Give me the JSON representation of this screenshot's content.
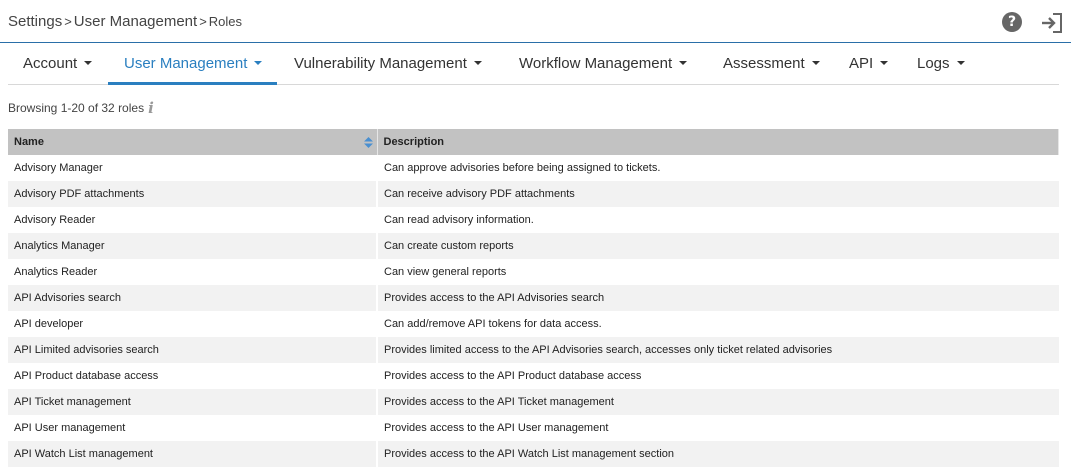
{
  "breadcrumb": {
    "items": [
      "Settings",
      "User Management",
      "Roles"
    ],
    "separator": ">"
  },
  "header": {
    "help_icon_glyph": "?",
    "icons": [
      "help-icon",
      "logout-icon"
    ]
  },
  "nav": {
    "active_color": "#2a7fc0",
    "tabs": [
      {
        "label": "Account",
        "active": false
      },
      {
        "label": "User Management",
        "active": true
      },
      {
        "label": "Vulnerability Management",
        "active": false
      },
      {
        "label": "Workflow Management",
        "active": false
      },
      {
        "label": "Assessment",
        "active": false
      },
      {
        "label": "API",
        "active": false
      },
      {
        "label": "Logs",
        "active": false
      }
    ]
  },
  "browsing": {
    "text": "Browsing 1-20 of 32 roles",
    "info_glyph": "i"
  },
  "table": {
    "columns": [
      "Name",
      "Description"
    ],
    "rows": [
      {
        "name": "Advisory Manager",
        "description": "Can approve advisories before being assigned to tickets."
      },
      {
        "name": "Advisory PDF attachments",
        "description": "Can receive advisory PDF attachments"
      },
      {
        "name": "Advisory Reader",
        "description": "Can read advisory information."
      },
      {
        "name": "Analytics Manager",
        "description": "Can create custom reports"
      },
      {
        "name": "Analytics Reader",
        "description": "Can view general reports"
      },
      {
        "name": "API Advisories search",
        "description": "Provides access to the API Advisories search"
      },
      {
        "name": "API developer",
        "description": "Can add/remove API tokens for data access."
      },
      {
        "name": "API Limited advisories search",
        "description": "Provides limited access to the API Advisories search, accesses only ticket related advisories"
      },
      {
        "name": "API Product database access",
        "description": "Provides access to the API Product database access"
      },
      {
        "name": "API Ticket management",
        "description": "Provides access to the API Ticket management"
      },
      {
        "name": "API User management",
        "description": "Provides access to the API User management"
      },
      {
        "name": "API Watch List management",
        "description": "Provides access to the API Watch List management section"
      }
    ]
  }
}
